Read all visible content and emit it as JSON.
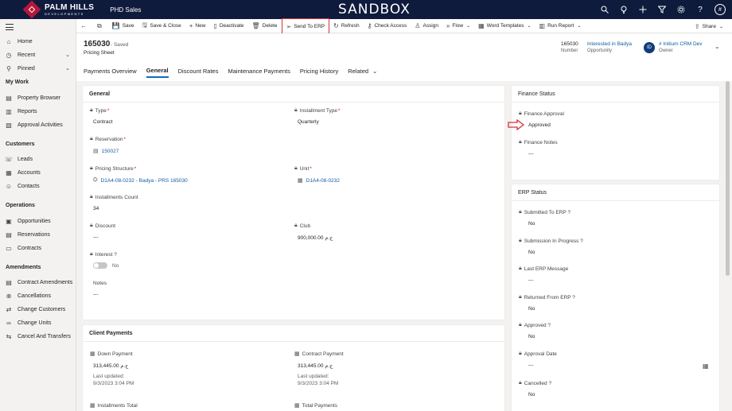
{
  "topbar": {
    "logo_main": "PALM HILLS",
    "logo_sub": "DEVELOPMENTS",
    "app_name": "PHD Sales",
    "environment": "SANDBOX",
    "user_initial": "#"
  },
  "sidebar": {
    "items": [
      {
        "label": "Home",
        "icon": "home-icon"
      },
      {
        "label": "Recent",
        "icon": "clock-icon"
      },
      {
        "label": "Pinned",
        "icon": "pin-icon"
      }
    ],
    "groups": [
      {
        "title": "My Work",
        "items": [
          {
            "label": "Property Browser"
          },
          {
            "label": "Reports"
          },
          {
            "label": "Approval Activities"
          }
        ]
      },
      {
        "title": "Customers",
        "items": [
          {
            "label": "Leads"
          },
          {
            "label": "Accounts"
          },
          {
            "label": "Contacts"
          }
        ]
      },
      {
        "title": "Operations",
        "items": [
          {
            "label": "Opportunities"
          },
          {
            "label": "Reservations"
          },
          {
            "label": "Contracts"
          }
        ]
      },
      {
        "title": "Amendments",
        "items": [
          {
            "label": "Contract Amendments"
          },
          {
            "label": "Cancellations"
          },
          {
            "label": "Change Customers"
          },
          {
            "label": "Change Units"
          },
          {
            "label": "Cancel And Transfers"
          }
        ]
      }
    ]
  },
  "commands": {
    "save": "Save",
    "save_close": "Save & Close",
    "new": "New",
    "deactivate": "Deactivate",
    "delete": "Delete",
    "send_erp": "Send To ERP",
    "refresh": "Refresh",
    "check_access": "Check Access",
    "assign": "Assign",
    "flow": "Flow",
    "word_templates": "Word Templates",
    "run_report": "Run Report",
    "share": "Share"
  },
  "header": {
    "record_number": "165030",
    "saved_status": "- Saved",
    "record_type": "Pricing Sheet",
    "number_value": "165030",
    "number_label": "Number",
    "opportunity_value": "Interested in Badya",
    "opportunity_label": "Opportunity",
    "owner_initials": "ID",
    "owner_value": "# Initium CRM Dev",
    "owner_label": "Owner"
  },
  "tabs": [
    "Payments Overview",
    "General",
    "Discount Rates",
    "Maintenance Payments",
    "Pricing History",
    "Related"
  ],
  "general": {
    "title": "General",
    "type_label": "Type",
    "type_value": "Contract",
    "installment_type_label": "Installment Type",
    "installment_type_value": "Quarterly",
    "reservation_label": "Reservation",
    "reservation_value": "150027",
    "pricing_structure_label": "Pricing Structure",
    "pricing_structure_value": "D1A4-08-0232 - Badya - PRS 165030",
    "unit_label": "Unit",
    "unit_value": "D1A4-08-0232",
    "installments_count_label": "Installments Count",
    "installments_count_value": "34",
    "discount_label": "Discount",
    "discount_value": "---",
    "club_label": "Club",
    "club_value": "900,000.00 ج.م",
    "interest_label": "Interest ?",
    "interest_value": "No",
    "notes_label": "Notes",
    "notes_value": "---"
  },
  "client_payments": {
    "title": "Client Payments",
    "down_payment_label": "Down Payment",
    "down_payment_value": "313,445.00 ج.م",
    "down_payment_updated": "Last updated:",
    "down_payment_date": "9/3/2023 3:04 PM",
    "contract_payment_label": "Contract Payment",
    "contract_payment_value": "313,445.00 ج.م",
    "contract_payment_updated": "Last updated:",
    "contract_payment_date": "9/3/2023 3:04 PM",
    "installments_total_label": "Installments Total",
    "total_payments_label": "Total Payments"
  },
  "finance_status": {
    "title": "Finance Status",
    "approval_label": "Finance Approval",
    "approval_value": "Approved",
    "notes_label": "Finance Notes",
    "notes_value": "---"
  },
  "erp_status": {
    "title": "ERP Status",
    "submitted_label": "Submitted To ERP ?",
    "submitted_value": "No",
    "in_progress_label": "Submission In Progress ?",
    "in_progress_value": "No",
    "last_msg_label": "Last ERP Message",
    "last_msg_value": "---",
    "returned_label": "Returned From ERP ?",
    "returned_value": "No",
    "approved_label": "Approved ?",
    "approved_value": "No",
    "approval_date_label": "Approval Date",
    "approval_date_value": "---",
    "cancelled_label": "Cancelled ?",
    "cancelled_value": "No"
  },
  "colors": {
    "topbar": "#0f1b3d",
    "brand": "#b5173a",
    "link": "#115ea3",
    "highlight": "#d13438",
    "tab_active": "#0f6cbd"
  }
}
